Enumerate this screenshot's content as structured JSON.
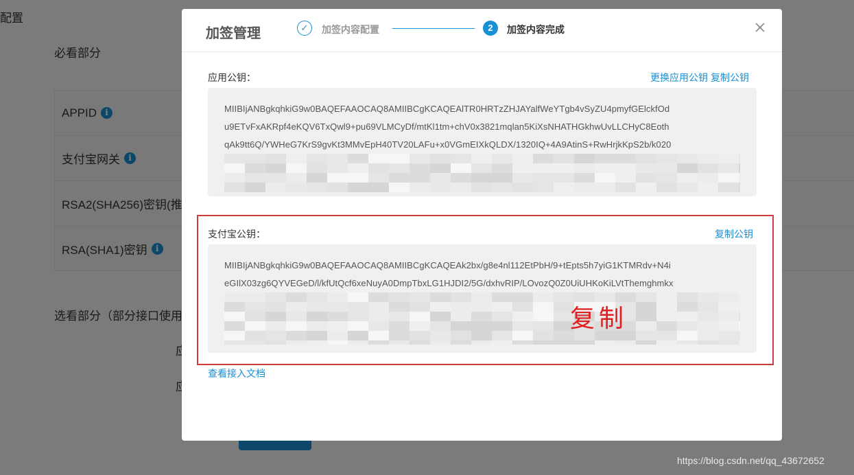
{
  "background": {
    "page_title": "配置",
    "required_section": "必看部分",
    "rows": [
      {
        "label": "APPID",
        "has_info": true
      },
      {
        "label": "支付宝网关",
        "has_info": true
      },
      {
        "label": "RSA2(SHA256)密钥(推",
        "has_info": false
      },
      {
        "label": "RSA(SHA1)密钥",
        "has_info": true
      }
    ],
    "optional_section": "选看部分（部分接口使用",
    "app_label_1": "应",
    "app_label_2": "应"
  },
  "modal": {
    "title": "加签管理",
    "steps": [
      {
        "label": "加签内容配置",
        "status": "done"
      },
      {
        "label": "加签内容完成",
        "number": "2",
        "status": "active"
      }
    ],
    "app_public_key": {
      "label": "应用公钥：",
      "change_link": "更换应用公钥",
      "copy_link": "复制公钥",
      "lines": [
        "MIIBIjANBgkqhkiG9w0BAQEFAAOCAQ8AMIIBCgKCAQEAlTR0HRTzZHJAYalfWeYTgb4vSyZU4pmyfGElckfOd",
        "u9ETvFxAKRpf4eKQV6TxQwl9+pu69VLMCyDf/mtKl1tm+chV0x3821mqlan5KiXsNHATHGkhwUvLLCHyC8Eoth",
        "qAk9tt6Q/YWHeG7KrS9gvKt3MMvEpH40TV20LAFu+x0VGmEIXkQLDX/1320IQ+4A9AtinS+RwHrjkKpS2b/k020"
      ]
    },
    "alipay_public_key": {
      "label": "支付宝公钥：",
      "copy_link": "复制公钥",
      "lines": [
        "MIIBIjANBgkqhkiG9w0BAQEFAAOCAQ8AMIIBCgKCAQEAk2bx/g8e4nl112EtPbH/9+tEpts5h7yiG1KTMRdv+N4i",
        "eGIlX03zg6QYVEGeD/l/kfUtQcf6xeNuyA0DmpTbxLG1HJDI2/5G/dxhvRIP/LOvozQ0Z0UiUHKoKiLVtThemghmkx"
      ]
    },
    "doc_link": "查看接入文档"
  },
  "annotation": "复制",
  "watermark": "https://blog.csdn.net/qq_43672652",
  "colors": {
    "accent": "#1890d5",
    "highlight_border": "#d23a3a",
    "annotation": "#e02020"
  }
}
